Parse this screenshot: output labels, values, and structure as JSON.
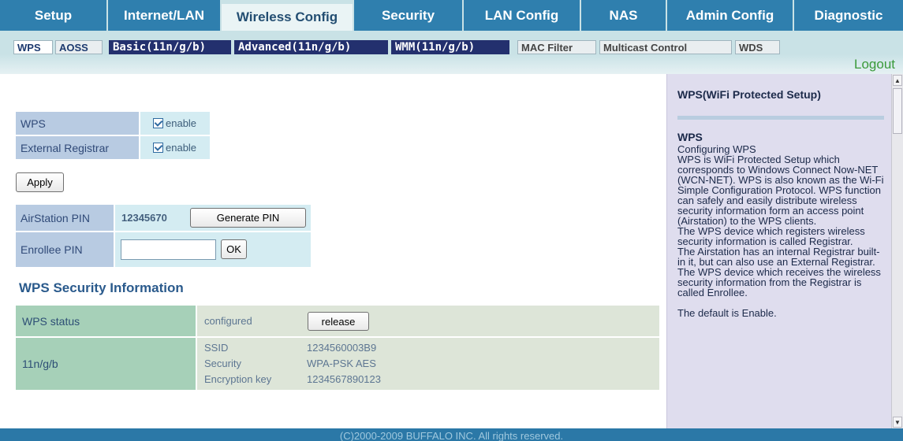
{
  "nav": {
    "tabs": [
      {
        "label": "Setup"
      },
      {
        "label": "Internet/LAN"
      },
      {
        "label": "Wireless Config"
      },
      {
        "label": "Security"
      },
      {
        "label": "LAN Config"
      },
      {
        "label": "NAS"
      },
      {
        "label": "Admin Config"
      },
      {
        "label": "Diagnostic"
      }
    ],
    "active_tab": "Wireless Config"
  },
  "subnav": {
    "items": [
      {
        "label": "WPS"
      },
      {
        "label": "AOSS"
      },
      {
        "label": "Basic(11n/g/b)"
      },
      {
        "label": "Advanced(11n/g/b)"
      },
      {
        "label": "WMM(11n/g/b)"
      },
      {
        "label": "MAC Filter"
      },
      {
        "label": "Multicast Control"
      },
      {
        "label": "WDS"
      }
    ],
    "active": "WPS"
  },
  "logout": "Logout",
  "wps_form": {
    "wps_label": "WPS",
    "wps_enable": "enable",
    "ext_registrar_label": "External Registrar",
    "ext_registrar_enable": "enable",
    "apply_button": "Apply",
    "airstation_pin_label": "AirStation PIN",
    "airstation_pin_value": "12345670",
    "generate_pin_button": "Generate PIN",
    "enrollee_pin_label": "Enrollee PIN",
    "enrollee_pin_value": "",
    "ok_button": "OK"
  },
  "security_info": {
    "title": "WPS Security Information",
    "status_label": "WPS status",
    "status_value": "configured",
    "release_button": "release",
    "band_label": "11n/g/b",
    "ssid_label": "SSID",
    "ssid_value": "1234560003B9",
    "security_label": "Security",
    "security_value": "WPA-PSK AES",
    "key_label": "Encryption key",
    "key_value": "1234567890123"
  },
  "help": {
    "title": "WPS(WiFi Protected Setup)",
    "subtitle": "WPS",
    "body": "Configuring WPS\nWPS is WiFi Protected Setup which corresponds to Windows Connect Now-NET (WCN-NET). WPS is also known as the Wi-Fi Simple Configuration Protocol. WPS function can safely and easily distribute wireless security information form an access point (Airstation) to the WPS clients.\nThe WPS device which registers wireless security information is called Registrar.\nThe Airstation has an internal Registrar built-in it, but can also use an External Registrar.\nThe WPS device which receives the wireless security information from the Registrar is called Enrollee.\n\nThe default is Enable."
  },
  "footer": "(C)2000-2009 BUFFALO INC. All rights reserved."
}
